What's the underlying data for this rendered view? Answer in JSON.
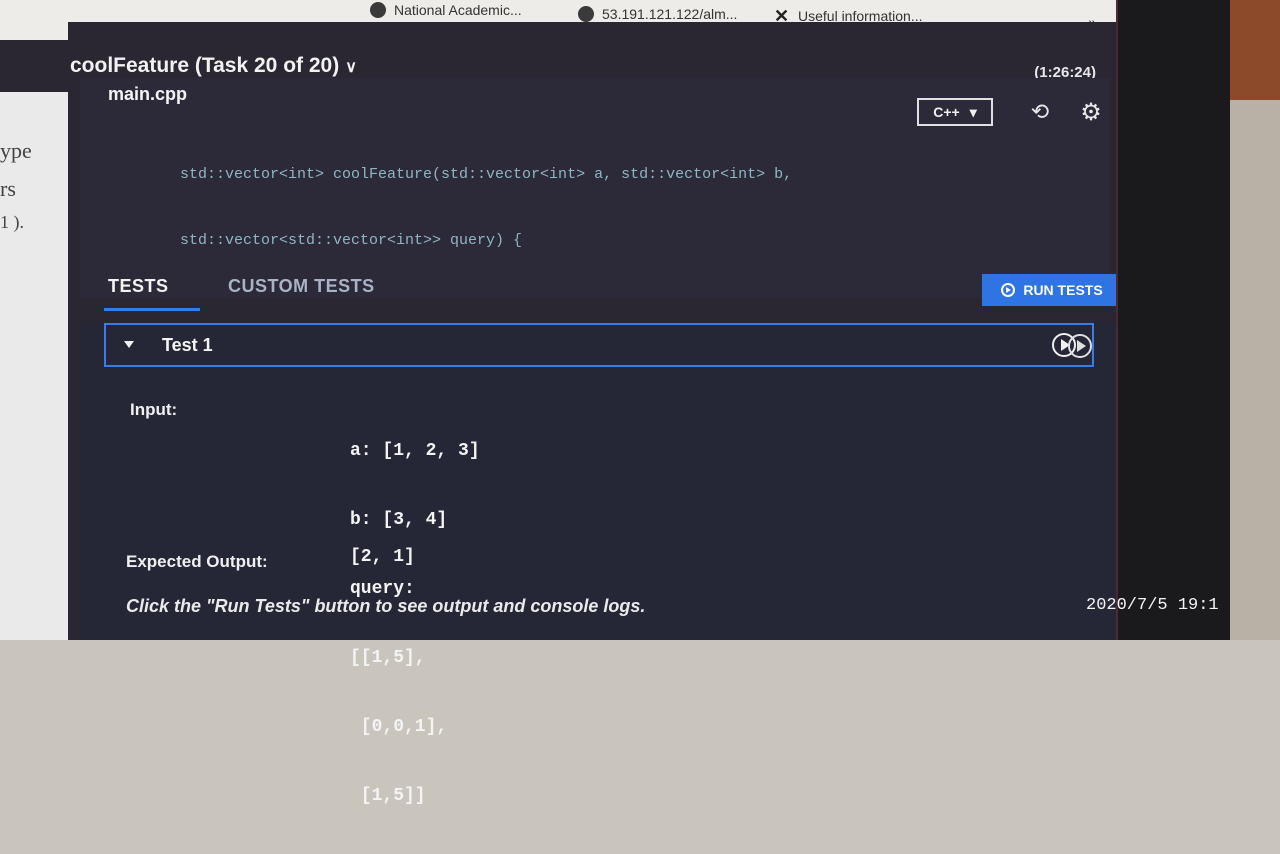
{
  "bookmarks": {
    "items": [
      {
        "label": "National Academic...",
        "icon": "globe-icon"
      },
      {
        "label": "53.191.121.122/alm...",
        "icon": "globe-icon"
      },
      {
        "label": "Useful information...",
        "icon": "tools-icon"
      }
    ],
    "more": "»"
  },
  "left_page": {
    "lines": [
      "ype",
      "rs",
      "1 )."
    ]
  },
  "header": {
    "task_title": "coolFeature (Task 20 of 20)",
    "chevron": "∨",
    "timer": "(1:26:24)"
  },
  "editor": {
    "filename": "main.cpp",
    "language": "C++",
    "language_caret": "▾",
    "code_lines": [
      "std::vector<int> coolFeature(std::vector<int> a, std::vector<int> b,",
      "std::vector<std::vector<int>> query) {",
      "",
      "}"
    ]
  },
  "tabs": {
    "tests": "TESTS",
    "custom_tests": "CUSTOM TESTS",
    "run_tests": "RUN TESTS"
  },
  "test": {
    "name": "Test 1",
    "input_label": "Input:",
    "input_lines": [
      "a: [1, 2, 3]",
      "b: [3, 4]",
      "query:",
      "[[1,5],",
      " [0,0,1],",
      " [1,5]]"
    ],
    "expected_label": "Expected Output:",
    "expected_value": "[2, 1]",
    "hint": "Click the \"Run Tests\" button to see output and console logs."
  },
  "photo_timestamp": "2020/7/5  19:1",
  "colors": {
    "accent": "#2f74e3",
    "background": "#2a2733",
    "keyword": "#d66a86"
  }
}
